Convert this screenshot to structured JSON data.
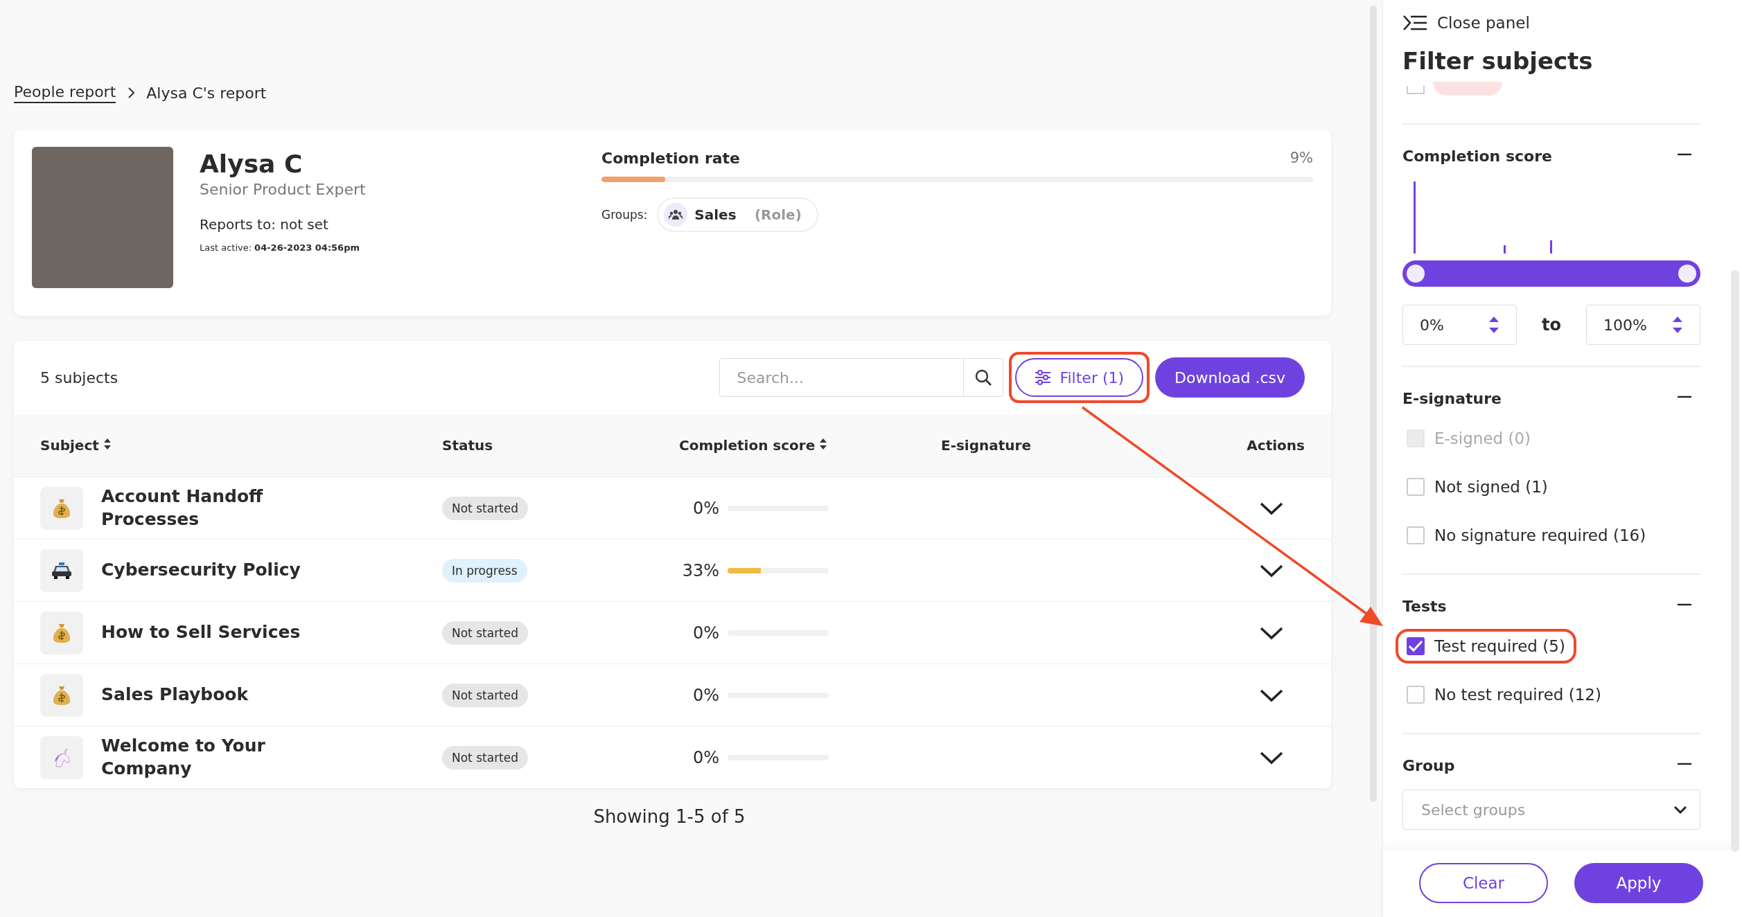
{
  "breadcrumb": [
    {
      "label": "People report",
      "link": true
    },
    {
      "label": "Alysa C's report",
      "link": false
    }
  ],
  "profile": {
    "name": "Alysa C",
    "title": "Senior Product Expert",
    "reports_to": "Reports to: not set",
    "last_active_label": "Last active:",
    "last_active": "04-26-2023 04:56pm",
    "completion_label": "Completion rate",
    "completion_value": "9%",
    "completion": {
      "level": 0.09
    },
    "groups_label": "Groups:",
    "groups": [
      {
        "name": "Sales",
        "role": "(Role)"
      }
    ]
  },
  "subjects": {
    "count": "5 subjects",
    "search": {
      "placeholder": "Search..."
    },
    "filter_button": "Filter (1)",
    "filter_highlighted": true,
    "download_button": "Download .csv",
    "columns": [
      {
        "label": "Subject",
        "sortable": true
      },
      {
        "label": "Status",
        "sortable": false
      },
      {
        "label": "Completion score",
        "sortable": true
      },
      {
        "label": "E-signature",
        "sortable": false
      },
      {
        "label": "Actions",
        "sortable": false
      }
    ],
    "rows": [
      {
        "kind": "bag",
        "title": "Account Handoff Processes",
        "status": {
          "label": "Not started",
          "kind": "not-started"
        },
        "score": "0%",
        "level": 0
      },
      {
        "kind": "car",
        "title": "Cybersecurity Policy",
        "status": {
          "label": "In progress",
          "kind": "in-progress"
        },
        "score": "33%",
        "level": 0.33
      },
      {
        "kind": "bag",
        "title": "How to Sell Services",
        "status": {
          "label": "Not started",
          "kind": "not-started"
        },
        "score": "0%",
        "level": 0
      },
      {
        "kind": "bag",
        "title": "Sales Playbook",
        "status": {
          "label": "Not started",
          "kind": "not-started"
        },
        "score": "0%",
        "level": 0
      },
      {
        "kind": "unicorn",
        "title": "Welcome to Your Company",
        "status": {
          "label": "Not started",
          "kind": "not-started"
        },
        "score": "0%",
        "level": 0
      }
    ],
    "footer": "Showing 1-5 of 5"
  },
  "annotation_arrow": true,
  "panel": {
    "close": "Close panel",
    "title": "Filter subjects",
    "partial_item": {
      "checked": false
    },
    "sections": [
      {
        "kind": "range",
        "title": "Completion score",
        "expanded": true,
        "low": {
          "value": "0%",
          "level": 0
        },
        "high": {
          "value": "100%",
          "level": 1
        },
        "separator": "to"
      },
      {
        "kind": "checkboxes",
        "title": "E-signature",
        "expanded": true,
        "options": [
          {
            "label": "E-signed (0)",
            "checked": false,
            "disabled": true,
            "highlighted": false
          },
          {
            "label": "Not signed (1)",
            "checked": false,
            "disabled": false,
            "highlighted": false
          },
          {
            "label": "No signature required (16)",
            "checked": false,
            "disabled": false,
            "highlighted": false
          }
        ]
      },
      {
        "kind": "checkboxes",
        "title": "Tests",
        "expanded": true,
        "options": [
          {
            "label": "Test required (5)",
            "checked": true,
            "disabled": false,
            "highlighted": true
          },
          {
            "label": "No test required (12)",
            "checked": false,
            "disabled": false,
            "highlighted": false
          }
        ]
      },
      {
        "kind": "select",
        "title": "Group",
        "expanded": true,
        "placeholder": "Select groups"
      }
    ],
    "buttons": {
      "clear": "Clear",
      "apply": "Apply"
    }
  }
}
